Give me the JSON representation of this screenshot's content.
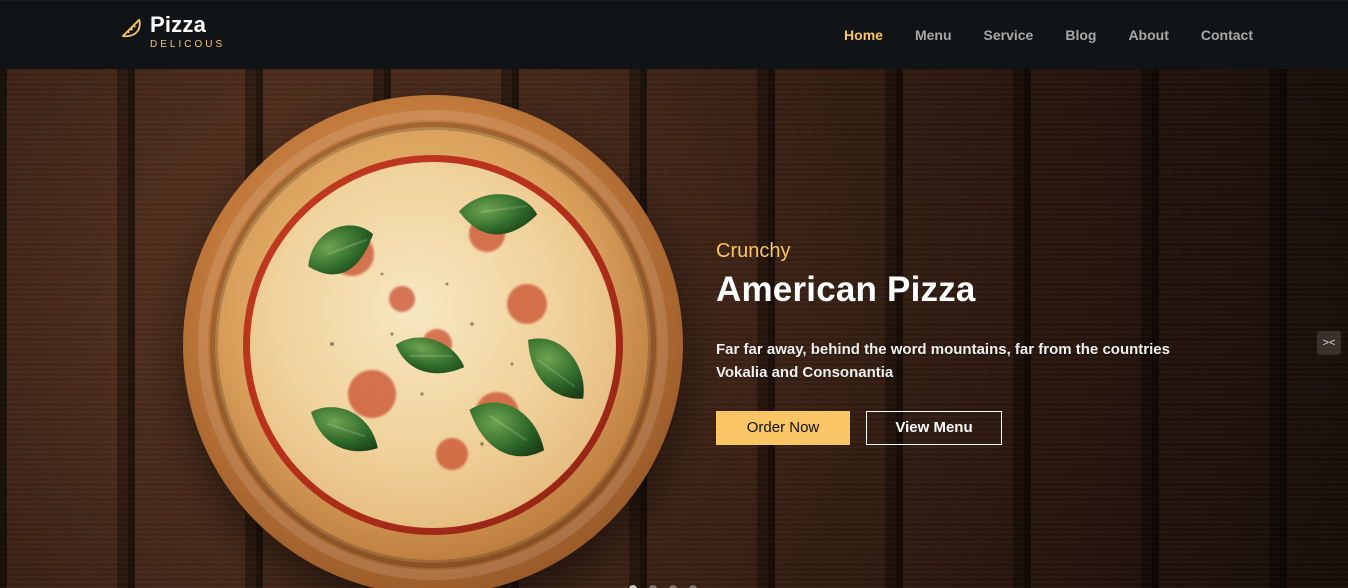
{
  "brand": {
    "title": "Pizza",
    "subtitle": "DELICOUS",
    "icon": "pizza-slice-icon",
    "accent": "#fac564"
  },
  "nav": {
    "items": [
      {
        "label": "Home",
        "active": true
      },
      {
        "label": "Menu",
        "active": false
      },
      {
        "label": "Service",
        "active": false
      },
      {
        "label": "Blog",
        "active": false
      },
      {
        "label": "About",
        "active": false
      },
      {
        "label": "Contact",
        "active": false
      }
    ]
  },
  "hero": {
    "subheading": "Crunchy",
    "headline": "American Pizza",
    "description": "Far far away, behind the word mountains, far from the countries Vokalia and Consonantia",
    "buttons": {
      "primary": "Order Now",
      "secondary": "View Menu"
    },
    "side_control_icon": "code-arrows-icon",
    "carousel_dots": 4,
    "active_dot": 0
  },
  "colors": {
    "nav_bg": "#111417",
    "accent": "#fac564",
    "text": "#ffffff",
    "muted_nav": "#a7a7a7"
  }
}
